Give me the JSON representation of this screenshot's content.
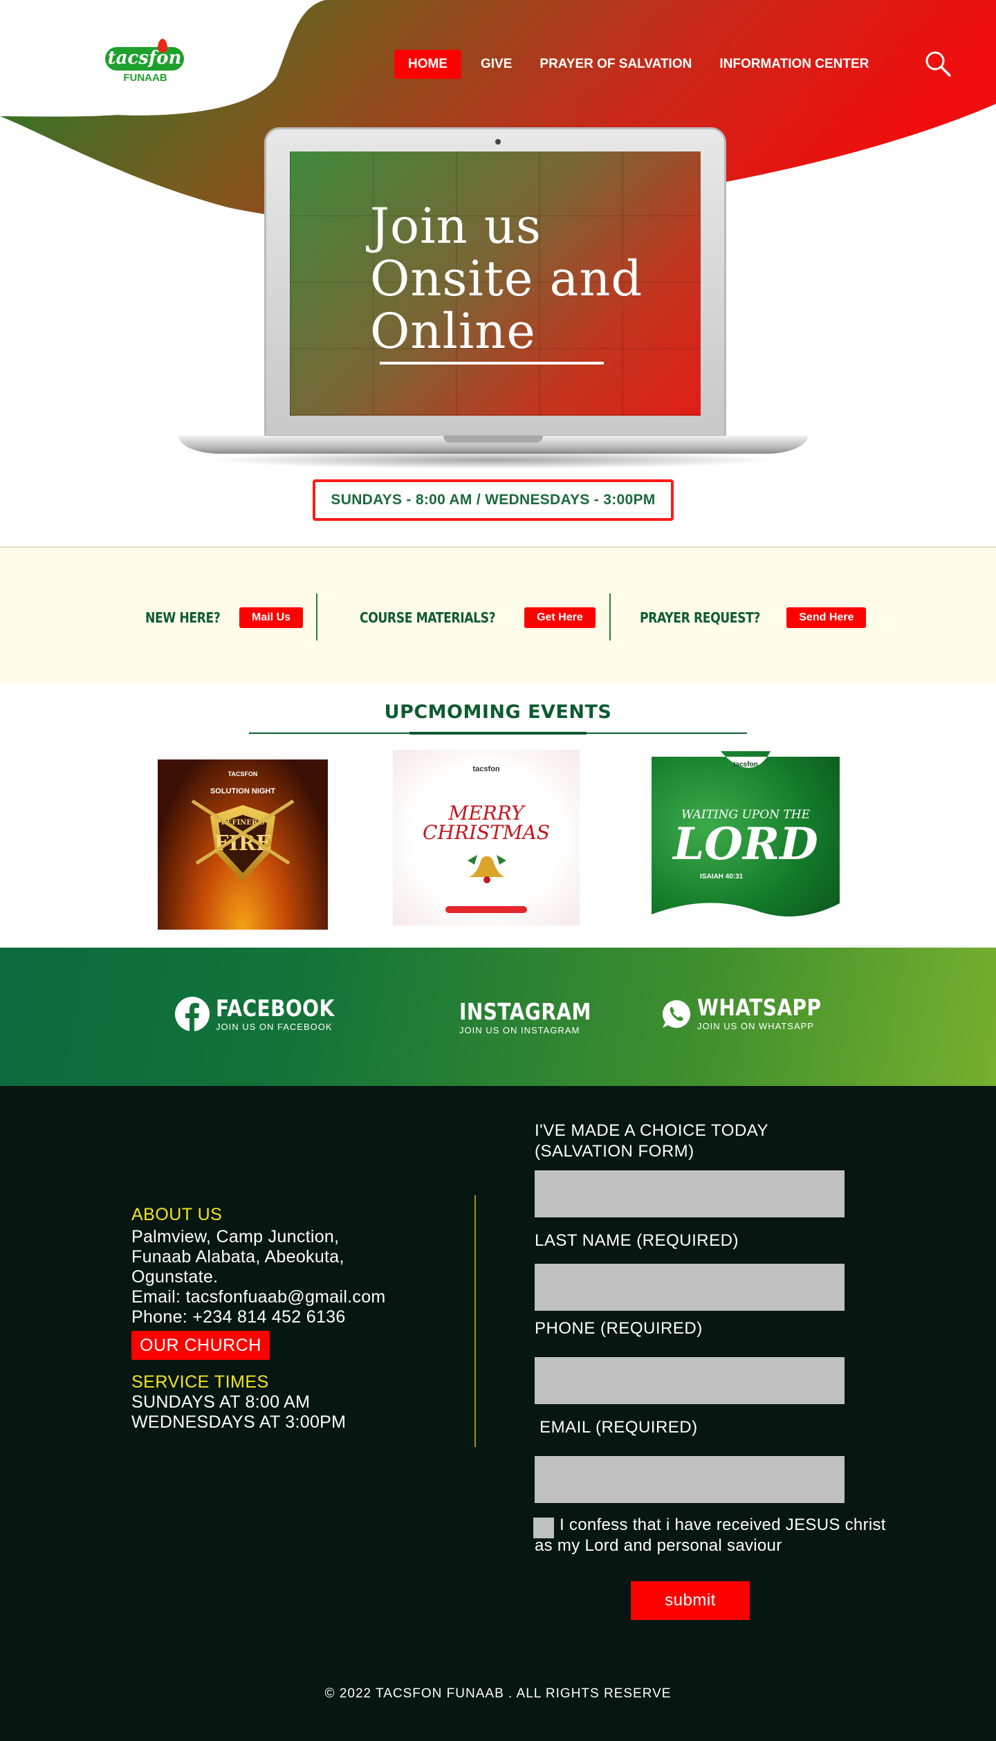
{
  "header": {
    "logo_text": "tacsfon",
    "logo_subtext": "FUNAAB",
    "nav": [
      {
        "label": "HOME",
        "active": true
      },
      {
        "label": "GIVE",
        "active": false
      },
      {
        "label": "PRAYER OF SALVATION",
        "active": false
      },
      {
        "label": "INFORMATION CENTER",
        "active": false
      }
    ],
    "search_icon": "search-icon"
  },
  "hero": {
    "screen_lines": [
      "Join us",
      "Onsite and",
      "Online"
    ],
    "service_times": "SUNDAYS - 8:00 AM / WEDNESDAYS - 3:00PM"
  },
  "cta": {
    "items": [
      {
        "label": "NEW HERE?",
        "button": "Mail Us"
      },
      {
        "label": "COURSE MATERIALS?",
        "button": "Get Here"
      },
      {
        "label": "PRAYER REQUEST?",
        "button": "Send Here"
      }
    ]
  },
  "events": {
    "title": "UPCMOMING EVENTS",
    "posters": [
      {
        "org": "TACSFON",
        "top": "SOLUTION NIGHT",
        "main": "FIRE",
        "sub": "REFINER'S"
      },
      {
        "org": "tacsfon",
        "line1": "MERRY",
        "line2": "CHRISTMAS"
      },
      {
        "org": "tacsfon",
        "line1": "WAITING UPON THE",
        "line2": "LORD",
        "ref": "ISAIAH 40:31"
      }
    ]
  },
  "social": {
    "items": [
      {
        "name": "FACEBOOK",
        "sub": "JOIN US ON FACEBOOK",
        "icon": "facebook-icon"
      },
      {
        "name": "INSTAGRAM",
        "sub": "JOIN US ON INSTAGRAM",
        "icon": ""
      },
      {
        "name": "WHATSAPP",
        "sub": "JOIN US ON WHATSAPP",
        "icon": "whatsapp-icon"
      }
    ]
  },
  "footer": {
    "about_heading": "ABOUT US",
    "address_lines": [
      "Palmview, Camp Junction,",
      "Funaab Alabata, Abeokuta,",
      "Ogunstate."
    ],
    "email": "Email: tacsfonfuaab@gmail.com",
    "phone": "Phone: +234 814 452 6136",
    "church_button": "OUR CHURCH",
    "service_heading": "SERVICE TIMES",
    "service_lines": [
      "SUNDAYS AT 8:00 AM",
      "WEDNESDAYS AT 3:00PM"
    ],
    "form": {
      "title_lines": [
        "I'VE MADE A CHOICE TODAY",
        "(SALVATION FORM)"
      ],
      "fields": [
        {
          "label": "",
          "value": ""
        },
        {
          "label": "LAST NAME (REQUIRED)",
          "value": ""
        },
        {
          "label": "PHONE (REQUIRED)",
          "value": ""
        },
        {
          "label": " EMAIL (REQUIRED)",
          "value": ""
        }
      ],
      "confess_text": "I confess that i have received JESUS christ as my Lord and personal saviour",
      "submit_label": "submit"
    },
    "copyright": "© 2022 TACSFON FUNAAB . ALL RIGHTS RESERVE"
  },
  "colors": {
    "accent_red": "#ff0000",
    "brand_green": "#0d5b2f",
    "footer_bg": "#061611",
    "footer_heading": "#f7e51d",
    "cta_bg": "#fffdea"
  }
}
